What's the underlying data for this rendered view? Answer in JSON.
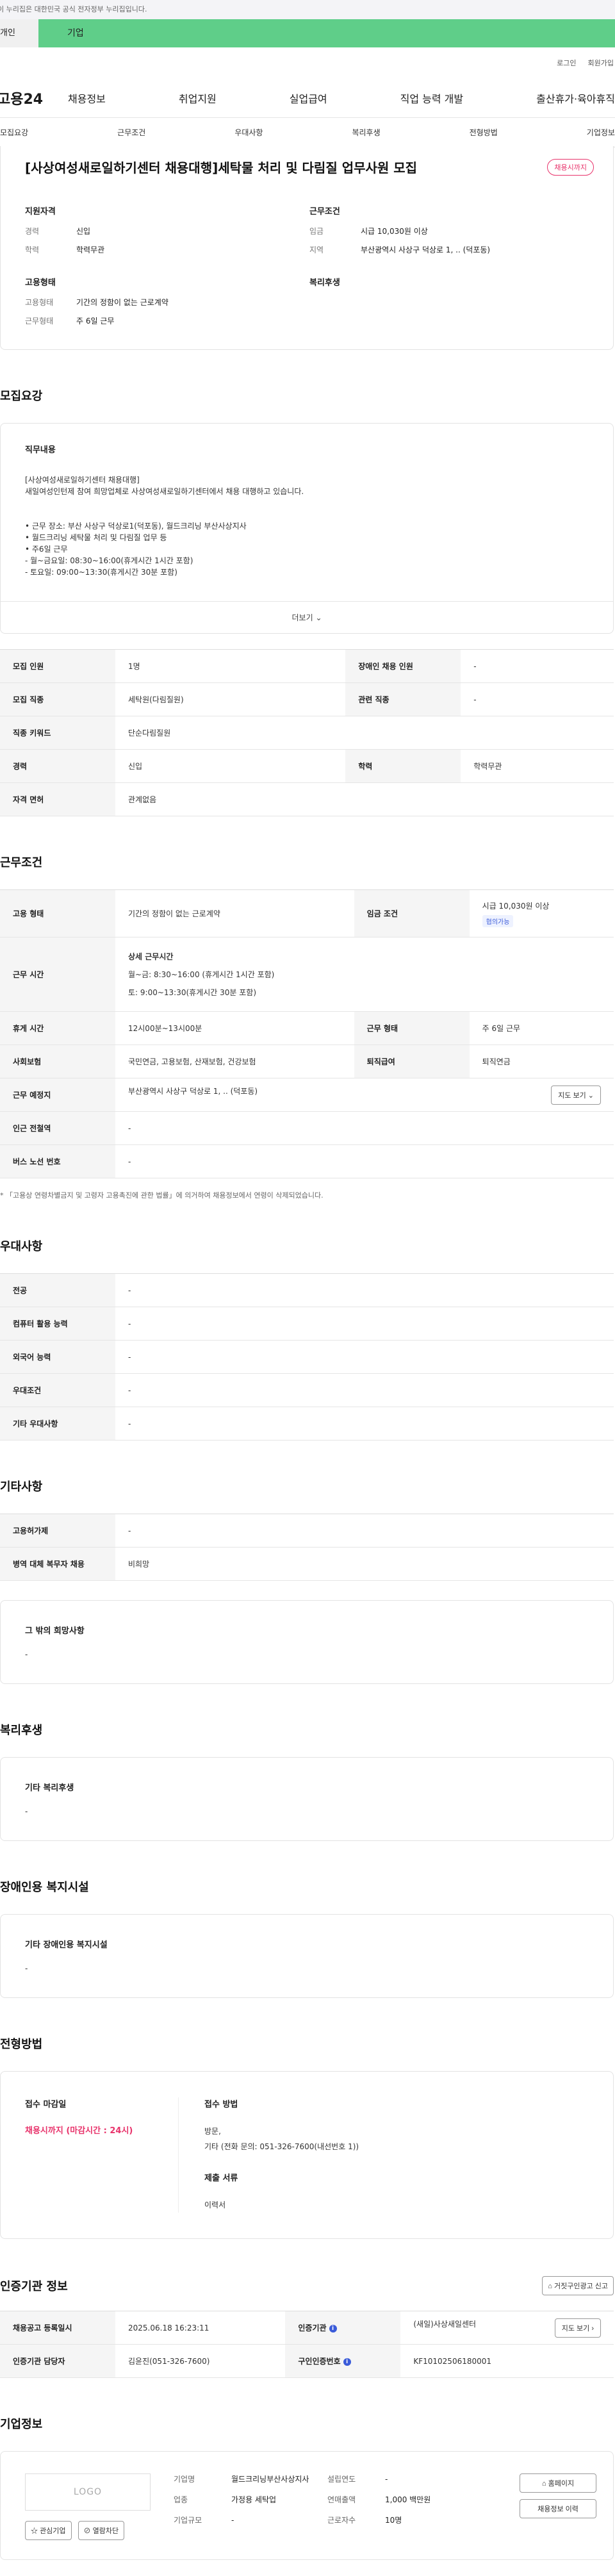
{
  "gov_banner": "이 누리집은 대한민국 공식 전자정부 누리집입니다.",
  "service_tabs": {
    "personal": "개인",
    "company": "기업"
  },
  "util": {
    "login": "로그인",
    "join": "회원가입"
  },
  "gnb": {
    "logo": "고용24",
    "items": [
      "채용정보",
      "취업지원",
      "실업급여",
      "직업 능력 개발",
      "출산휴가·육아휴직"
    ]
  },
  "anchor_tabs": [
    "모집요강",
    "근무조건",
    "우대사항",
    "복리후생",
    "전형방법",
    "기업정보"
  ],
  "summary": {
    "title": "[사상여성새로일하기센터 채용대행]세탁물 처리 및 다림질 업무사원 모집",
    "badge": "채용시까지",
    "qual": {
      "heading": "지원자격",
      "career_k": "경력",
      "career_v": "신입",
      "edu_k": "학력",
      "edu_v": "학력무관"
    },
    "cond": {
      "heading": "근무조건",
      "wage_k": "임금",
      "wage_v": "시급 10,030원 이상",
      "area_k": "지역",
      "area_v": "부산광역시 사상구 덕상로 1, .. (덕포동)"
    },
    "emp": {
      "heading": "고용형태",
      "type_k": "고용형태",
      "type_v": "기간의 정함이 없는 근로계약",
      "work_k": "근무형태",
      "work_v": "주 6일 근무"
    },
    "welfare": {
      "heading": "복리후생"
    }
  },
  "recruit": {
    "section_title": "모집요강",
    "duty_heading": "직무내용",
    "duty_text": "[사상여성새로일하기센터 채용대행]\n새일여성인턴제 참여 희망업체로 사상여성새로일하기센터에서 채용 대행하고 있습니다.\n\n\n• 근무 장소: 부산 사상구 덕상로1(덕포동), 월드크리닝 부산사상지사\n• 월드크리닝 세탁물 처리 및 다림질 업무 등\n• 주6일 근무\n  - 월~금요일: 08:30~16:00(휴게시간 1시간 포함)\n  - 토요일: 09:00~13:30(휴게시간 30분 포함)",
    "more": "더보기",
    "rows": [
      {
        "k1": "모집 인원",
        "v1": "1명",
        "k2": "장애인 채용 인원",
        "v2": "-"
      },
      {
        "k1": "모집 직종",
        "v1": "세탁원(다림질원)",
        "k2": "관련 직종",
        "v2": "-"
      },
      {
        "k1": "직종 키워드",
        "v1": "단순다림질원",
        "k2": "",
        "v2": ""
      },
      {
        "k1": "경력",
        "v1": "신입",
        "k2": "학력",
        "v2": "학력무관"
      },
      {
        "k1": "자격 면허",
        "v1": "관계없음",
        "k2": "",
        "v2": ""
      }
    ]
  },
  "work": {
    "section_title": "근무조건",
    "emp_type_k": "고용 형태",
    "emp_type_v": "기간의 정함이 없는 근로계약",
    "wage_k": "임금 조건",
    "wage_v": "시급 10,030원 이상",
    "wage_tag": "협의가능",
    "hours_k": "근무 시간",
    "hours_title": "상세 근무시간",
    "hours_l1": "월~금: 8:30~16:00 (휴게시간 1시간 포함)",
    "hours_l2": "토: 9:00~13:30(휴게시간 30분 포함)",
    "break_k": "휴게 시간",
    "break_v": "12시00분~13시00분",
    "form_k": "근무 형태",
    "form_v": "주 6일 근무",
    "ins_k": "사회보험",
    "ins_v": "국민연금, 고용보험, 산재보험, 건강보험",
    "ret_k": "퇴직급여",
    "ret_v": "퇴직연금",
    "place_k": "근무 예정지",
    "place_v": "부산광역시 사상구 덕상로 1, .. (덕포동)",
    "map_btn": "지도 보기",
    "subway_k": "인근 전철역",
    "subway_v": "-",
    "bus_k": "버스 노선 번호",
    "bus_v": "-",
    "note": "* 「고용상 연령차별금지 및 고령자 고용촉진에 관한 법률」에 의거하여 채용정보에서 연령이 삭제되었습니다."
  },
  "pref": {
    "section_title": "우대사항",
    "rows": [
      {
        "k": "전공",
        "v": "-"
      },
      {
        "k": "컴퓨터 활용 능력",
        "v": "-"
      },
      {
        "k": "외국어 능력",
        "v": "-"
      },
      {
        "k": "우대조건",
        "v": "-"
      },
      {
        "k": "기타 우대사항",
        "v": "-"
      }
    ]
  },
  "etc": {
    "section_title": "기타사항",
    "rows": [
      {
        "k": "고용허가제",
        "v": "-"
      },
      {
        "k": "병역 대체 복무자 채용",
        "v": "비희망"
      }
    ],
    "other_heading": "그 밖의 희망사항",
    "other_v": "-"
  },
  "welfare": {
    "section_title": "복리후생",
    "heading": "기타 복리후생",
    "v": "-"
  },
  "disabled": {
    "section_title": "장애인용 복지시설",
    "heading": "기타 장애인용 복지시설",
    "v": "-"
  },
  "apply": {
    "section_title": "전형방법",
    "deadline_heading": "접수 마감일",
    "deadline_v": "채용시까지 (마감시간 : 24시)",
    "method_heading": "접수 방법",
    "method_l1": "방문,",
    "method_l2": "기타 (전화 문의: 051-326-7600(내선번호 1))",
    "docs_heading": "제출 서류",
    "docs_v": "이력서"
  },
  "agency": {
    "section_title": "인증기관 정보",
    "report_btn": "거짓구인광고 신고",
    "reg_k": "채용공고 등록일시",
    "reg_v": "2025.06.18 16:23:11",
    "org_k": "인증기관",
    "org_v": "(새일)사상새일센터",
    "map_btn": "지도 보기",
    "staff_k": "인증기관 담당자",
    "staff_v": "김윤진(051-326-7600)",
    "cert_k": "구인인증번호",
    "cert_v": "KF10102506180001"
  },
  "company": {
    "section_title": "기업정보",
    "logo_text": "LOGO",
    "fav_btn": "관심기업",
    "block_btn": "열람차단",
    "name_k": "기업명",
    "name_v": "월드크리닝부산사상지사",
    "year_k": "설립연도",
    "year_v": "-",
    "industry_k": "업종",
    "industry_v": "가정용 세탁업",
    "sales_k": "연매출액",
    "sales_v": "1,000 백만원",
    "scale_k": "기업규모",
    "scale_v": "-",
    "staff_k": "근로자수",
    "staff_v": "10명",
    "home_btn": "홈페이지",
    "history_btn": "채용정보 이력"
  }
}
